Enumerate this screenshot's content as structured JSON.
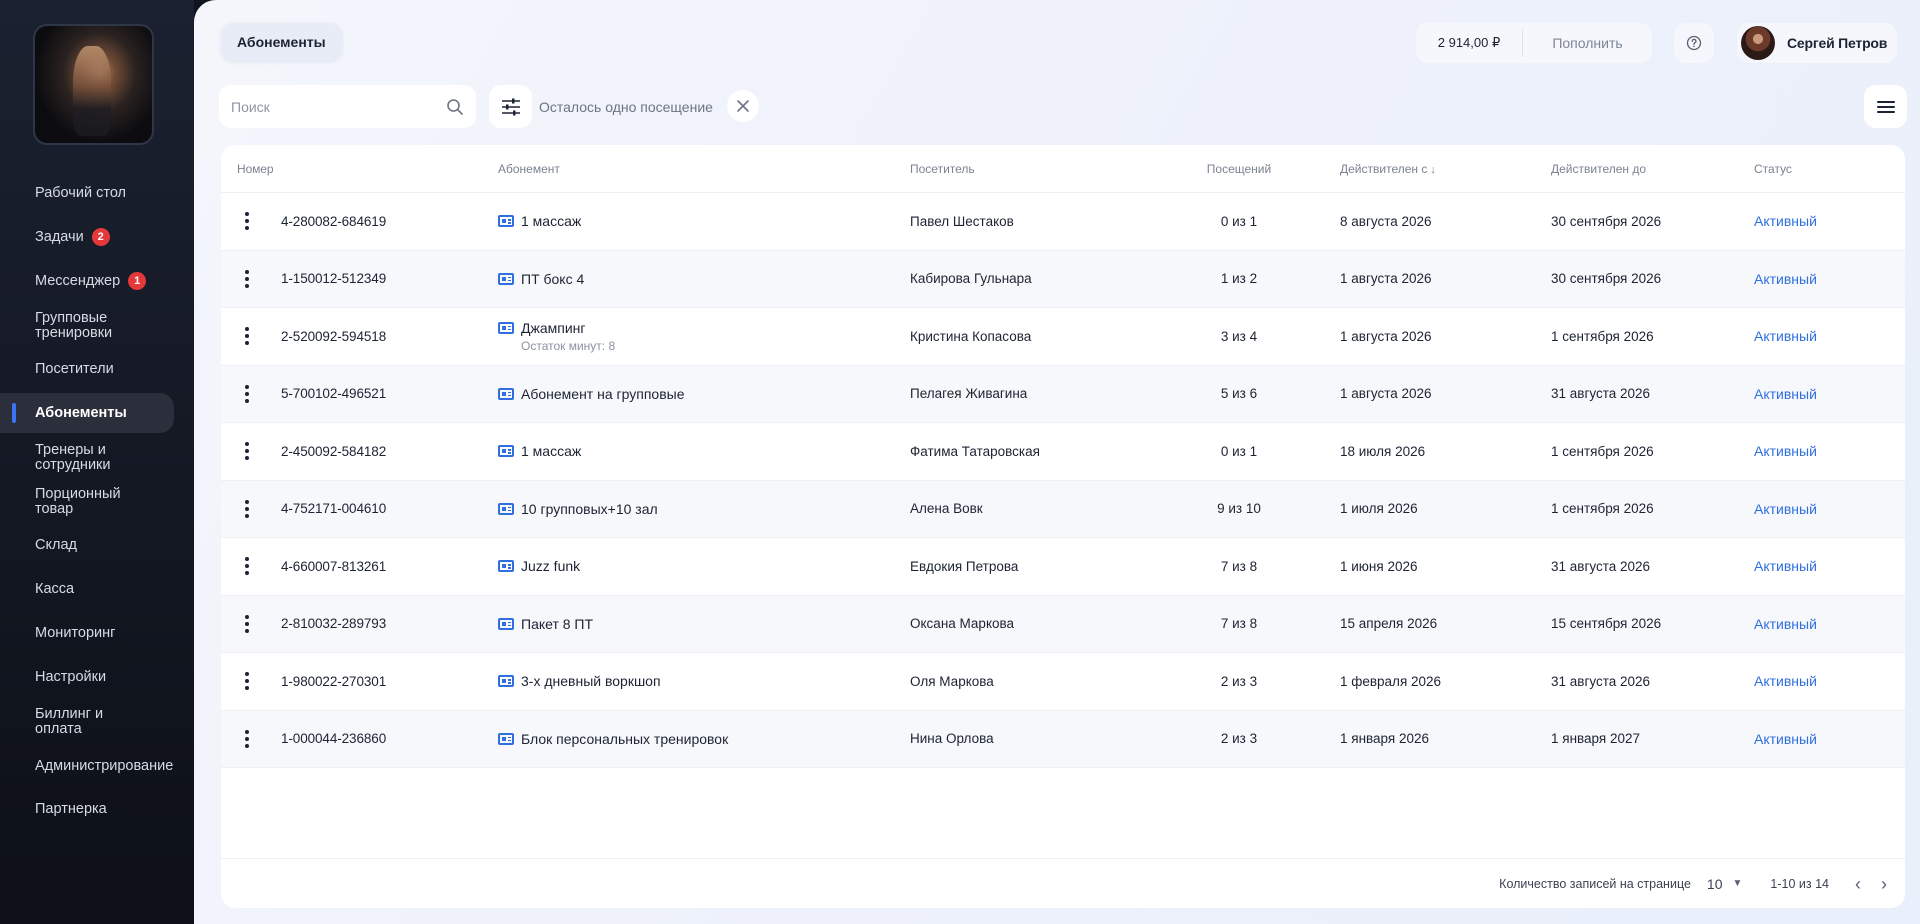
{
  "sidebar": {
    "items": [
      {
        "label": "Рабочий стол"
      },
      {
        "label": "Задачи",
        "badge": "2"
      },
      {
        "label": "Мессенджер",
        "badge": "1"
      },
      {
        "label": "Групповые тренировки"
      },
      {
        "label": "Посетители"
      },
      {
        "label": "Абонементы",
        "active": true
      },
      {
        "label": "Тренеры и сотрудники"
      },
      {
        "label": "Порционный товар"
      },
      {
        "label": "Склад"
      },
      {
        "label": "Касса"
      },
      {
        "label": "Мониторинг"
      },
      {
        "label": "Настройки"
      },
      {
        "label": "Биллинг и оплата"
      },
      {
        "label": "Администрирование"
      },
      {
        "label": "Партнерка"
      }
    ]
  },
  "header": {
    "tab": "Абонементы",
    "balance": "2 914,00 ₽",
    "topup_label": "Пополнить",
    "user_name": "Сергей Петров"
  },
  "filters": {
    "search_placeholder": "Поиск",
    "active_filter": "Осталось одно посещение"
  },
  "table": {
    "columns": {
      "number": "Номер",
      "subscription": "Абонемент",
      "visitor": "Посетитель",
      "visits": "Посещений",
      "valid_from": "Действителен с",
      "valid_to": "Действителен до",
      "status": "Статус"
    },
    "rows": [
      {
        "number": "4-280082-684619",
        "subscription": "1 массаж",
        "note": "",
        "visitor": "Павел Шестаков",
        "visits": "0 из 1",
        "from": "8 августа 2026",
        "to": "30 сентября 2026",
        "status": "Активный"
      },
      {
        "number": "1-150012-512349",
        "subscription": "ПТ бокс 4",
        "note": "",
        "visitor": "Кабирова Гульнара",
        "visits": "1 из 2",
        "from": "1 августа 2026",
        "to": "30 сентября 2026",
        "status": "Активный"
      },
      {
        "number": "2-520092-594518",
        "subscription": "Джампинг",
        "note": "Остаток минут: 8",
        "visitor": "Кристина Копасова",
        "visits": "3 из 4",
        "from": "1 августа 2026",
        "to": "1 сентября 2026",
        "status": "Активный"
      },
      {
        "number": "5-700102-496521",
        "subscription": "Абонемент на групповые",
        "note": "",
        "visitor": "Пелагея Живагина",
        "visits": "5 из 6",
        "from": "1 августа 2026",
        "to": "31 августа 2026",
        "status": "Активный"
      },
      {
        "number": "2-450092-584182",
        "subscription": "1 массаж",
        "note": "",
        "visitor": "Фатима Татаровская",
        "visits": "0 из 1",
        "from": "18 июля 2026",
        "to": "1 сентября 2026",
        "status": "Активный"
      },
      {
        "number": "4-752171-004610",
        "subscription": "10 групповых+10 зал",
        "note": "",
        "visitor": "Алена Вовк",
        "visits": "9 из 10",
        "from": "1 июля 2026",
        "to": "1 сентября 2026",
        "status": "Активный"
      },
      {
        "number": "4-660007-813261",
        "subscription": "Juzz funk",
        "note": "",
        "visitor": "Евдокия Петрова",
        "visits": "7 из 8",
        "from": "1 июня 2026",
        "to": "31 августа 2026",
        "status": "Активный"
      },
      {
        "number": "2-810032-289793",
        "subscription": "Пакет 8 ПТ",
        "note": "",
        "visitor": "Оксана Маркова",
        "visits": "7 из 8",
        "from": "15 апреля 2026",
        "to": "15 сентября 2026",
        "status": "Активный"
      },
      {
        "number": "1-980022-270301",
        "subscription": "3-х дневный воркшоп",
        "note": "",
        "visitor": "Оля Маркова",
        "visits": "2 из 3",
        "from": "1 февраля 2026",
        "to": "31 августа 2026",
        "status": "Активный"
      },
      {
        "number": "1-000044-236860",
        "subscription": "Блок персональных тренировок",
        "note": "",
        "visitor": "Нина Орлова",
        "visits": "2 из 3",
        "from": "1 января 2026",
        "to": "1 января 2027",
        "status": "Активный"
      }
    ]
  },
  "pagination": {
    "per_page_label": "Количество записей на странице",
    "per_page_value": "10",
    "range": "1-10 из 14"
  },
  "icons": {
    "search": "search-icon",
    "filter": "sliders-icon",
    "close": "close-icon",
    "menu": "hamburger-icon",
    "help": "question-icon",
    "row_menu": "kebab-icon",
    "subscription": "ticket-icon",
    "prev": "chevron-left-icon",
    "next": "chevron-right-icon"
  },
  "colors": {
    "accent": "#2f6fe0",
    "badge": "#e5383b",
    "sidebar_bg": "#141924"
  }
}
